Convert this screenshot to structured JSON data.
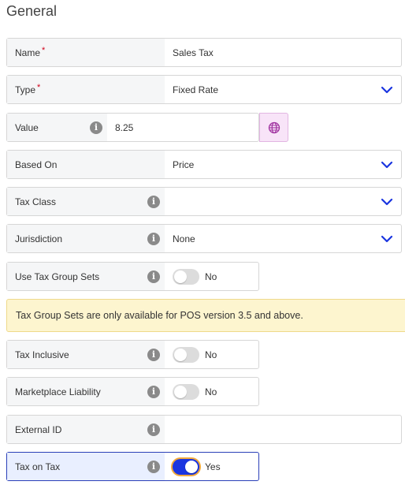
{
  "section": {
    "title": "General"
  },
  "fields": {
    "name": {
      "label": "Name",
      "required": "*",
      "value": "Sales Tax"
    },
    "type": {
      "label": "Type",
      "required": "*",
      "value": "Fixed Rate"
    },
    "value": {
      "label": "Value",
      "value": "8.25"
    },
    "based_on": {
      "label": "Based On",
      "value": "Price"
    },
    "tax_class": {
      "label": "Tax Class",
      "value": ""
    },
    "jurisdiction": {
      "label": "Jurisdiction",
      "value": "None"
    },
    "use_tax_group_sets": {
      "label": "Use Tax Group Sets",
      "state": "No",
      "on": false
    },
    "tax_inclusive": {
      "label": "Tax Inclusive",
      "state": "No",
      "on": false
    },
    "marketplace_liability": {
      "label": "Marketplace Liability",
      "state": "No",
      "on": false
    },
    "external_id": {
      "label": "External ID",
      "value": ""
    },
    "tax_on_tax": {
      "label": "Tax on Tax",
      "state": "Yes",
      "on": true
    }
  },
  "notice": {
    "text": "Tax Group Sets are only available for POS version 3.5 and above."
  },
  "icons": {
    "info": "info-icon",
    "dropdown": "chevron-down-icon",
    "globe": "globe-icon"
  },
  "info_glyph": "i",
  "colors": {
    "accent": "#1a35e0",
    "required": "#d0021b",
    "notice_bg": "#fdf5cf",
    "globe_bg": "#f8e4f8"
  }
}
